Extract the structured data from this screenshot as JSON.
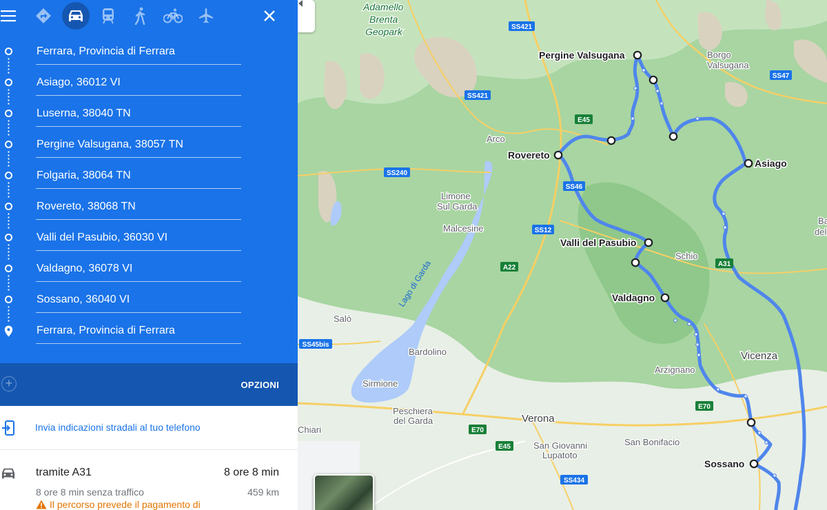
{
  "panel": {
    "travel_modes": [
      {
        "name": "best-route",
        "icon": "diamond-directions-icon"
      },
      {
        "name": "car",
        "icon": "car-icon",
        "active": true
      },
      {
        "name": "transit",
        "icon": "train-icon"
      },
      {
        "name": "walking",
        "icon": "walking-icon"
      },
      {
        "name": "cycling",
        "icon": "bicycle-icon"
      },
      {
        "name": "flight",
        "icon": "airplane-icon"
      }
    ],
    "waypoints": [
      "Ferrara, Provincia di Ferrara",
      "Asiago, 36012 VI",
      "Luserna, 38040 TN",
      "Pergine Valsugana, 38057 TN",
      "Folgaria, 38064 TN",
      "Rovereto, 38068 TN",
      "Valli del Pasubio, 36030 VI",
      "Valdagno, 36078 VI",
      "Sossano, 36040 VI",
      "Ferrara, Provincia di Ferrara"
    ],
    "options_label": "OPZIONI",
    "send_label": "Invia indicazioni stradali al tuo telefono",
    "route": {
      "via": "tramite A31",
      "duration": "8 ore 8 min",
      "no_traffic": "8 ore 8 min senza traffico",
      "distance": "459 km",
      "warning": "Il percorso prevede il pagamento di"
    }
  },
  "colors": {
    "primary": "#1a73e8",
    "primary_dark": "#1557b0",
    "route": "#5b8ff0",
    "water": "#aecbfa",
    "warning": "#e37400"
  },
  "map": {
    "places": {
      "adamello": "Adamello",
      "brenta": "Brenta",
      "geopark": "Geopark",
      "pergine": "Pergine Valsugana",
      "borgo1": "Borgo",
      "borgo2": "Valsugana",
      "arco": "Arco",
      "rovereto": "Rovereto",
      "asiago": "Asiago",
      "limone1": "Limone",
      "limone2": "Sul Garda",
      "malcesine": "Malcesine",
      "valli": "Valli del Pasubio",
      "schio": "Schio",
      "valdagno": "Valdagno",
      "lago": "Lago di Garda",
      "salo": "Salò",
      "bardolino": "Bardolino",
      "vicenza": "Vicenza",
      "arzignano": "Arzignano",
      "sirmione": "Sirmione",
      "peschiera1": "Peschiera",
      "peschiera2": "del Garda",
      "verona": "Verona",
      "sangiovanni1": "San Giovanni",
      "sangiovanni2": "Lupatoto",
      "sanbonifacio": "San Bonifacio",
      "sossano": "Sossano",
      "chiari": "Chiari",
      "ba1": "Ba",
      "ba2": "del"
    },
    "roads": {
      "ss421a": "SS421",
      "ss421b": "SS421",
      "ss47": "SS47",
      "e45a": "E45",
      "ss240": "SS240",
      "ss46": "SS46",
      "ss12": "SS12",
      "a22": "A22",
      "a31": "A31",
      "ss45bis": "SS45bis",
      "e70a": "E70",
      "e70b": "E70",
      "e45b": "E45",
      "ss434": "SS434"
    }
  }
}
